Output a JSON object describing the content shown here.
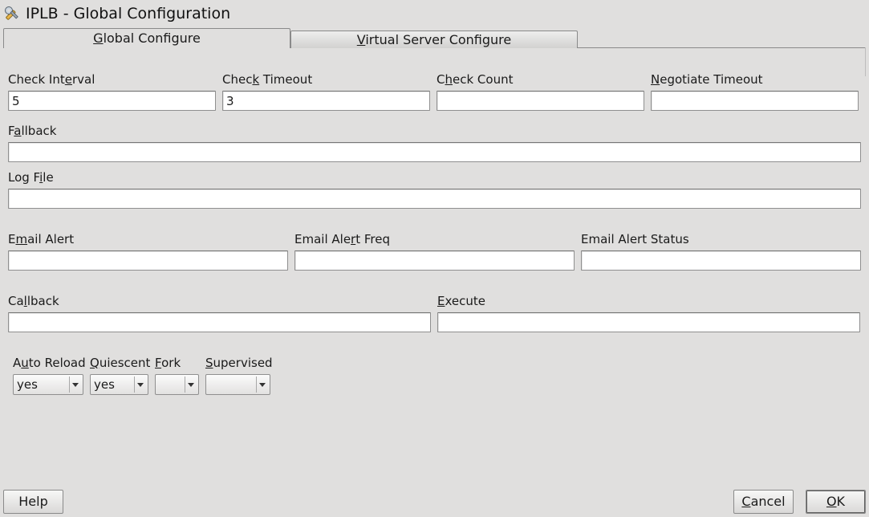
{
  "window": {
    "title": "IPLB - Global Configuration",
    "icon": "wrench-screwdriver-icon"
  },
  "tabs": [
    {
      "label": "Global Configure",
      "mnemonic": "G",
      "active": true
    },
    {
      "label": "Virtual Server Configure",
      "mnemonic": "V",
      "active": false
    }
  ],
  "fields": {
    "check_interval": {
      "label": "Check Interval",
      "value": "5"
    },
    "check_timeout": {
      "label": "Check Timeout",
      "value": "3"
    },
    "check_count": {
      "label": "Check Count",
      "value": ""
    },
    "negotiate_timeout": {
      "label": "Negotiate Timeout",
      "value": ""
    },
    "fallback": {
      "label": "Fallback",
      "value": ""
    },
    "log_file": {
      "label": "Log File",
      "value": ""
    },
    "email_alert": {
      "label": "Email Alert",
      "value": ""
    },
    "email_alert_freq": {
      "label": "Email Alert Freq",
      "value": ""
    },
    "email_alert_status": {
      "label": "Email Alert Status",
      "value": ""
    },
    "callback": {
      "label": "Callback",
      "value": ""
    },
    "execute": {
      "label": "Execute",
      "value": ""
    }
  },
  "combos": {
    "auto_reload": {
      "label": "Auto Reload",
      "value": "yes"
    },
    "quiescent": {
      "label": "Quiescent",
      "value": "yes"
    },
    "fork": {
      "label": "Fork",
      "value": ""
    },
    "supervised": {
      "label": "Supervised",
      "value": ""
    }
  },
  "buttons": {
    "help": "Help",
    "cancel": "Cancel",
    "ok": "OK"
  },
  "colors": {
    "window_bg": "#e0dfde",
    "field_bg": "#ffffff",
    "border": "#8f8f8f"
  }
}
